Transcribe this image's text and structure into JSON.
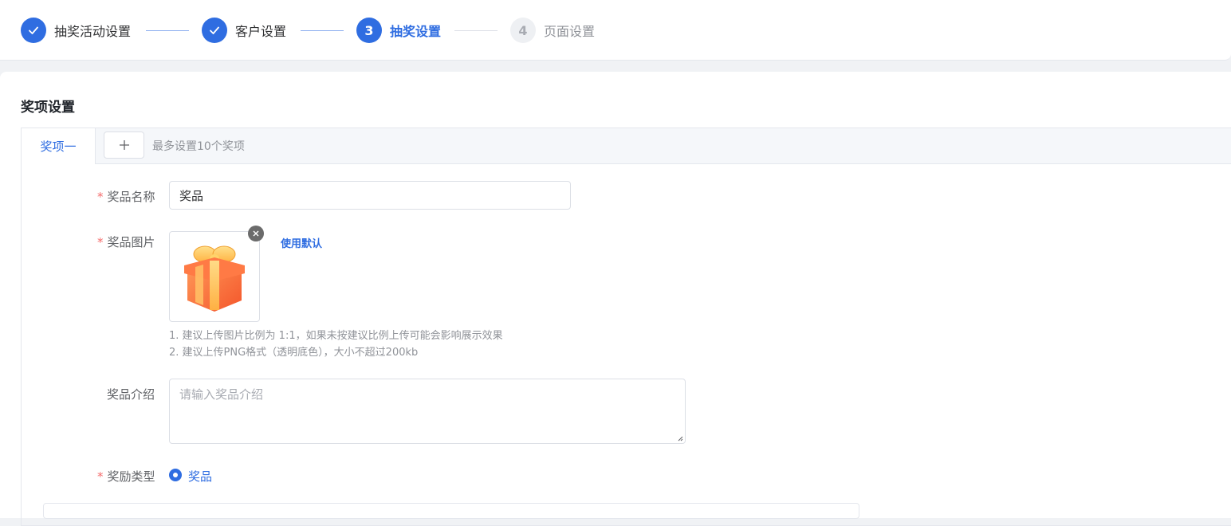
{
  "steps": [
    {
      "number": "1",
      "label": "抽奖活动设置",
      "state": "done"
    },
    {
      "number": "2",
      "label": "客户设置",
      "state": "done"
    },
    {
      "number": "3",
      "label": "抽奖设置",
      "state": "active"
    },
    {
      "number": "4",
      "label": "页面设置",
      "state": "todo"
    }
  ],
  "section": {
    "title": "奖项设置"
  },
  "tabs": {
    "items": [
      {
        "label": "奖项一"
      }
    ],
    "add_icon": "plus-icon",
    "hint": "最多设置10个奖项"
  },
  "form": {
    "prize_name": {
      "label": "奖品名称",
      "required": "*",
      "value": "奖品"
    },
    "prize_image": {
      "label": "奖品图片",
      "required": "*",
      "use_default": "使用默认",
      "image_icon": "gift-box-icon",
      "hints": [
        "1. 建议上传图片比例为 1:1，如果未按建议比例上传可能会影响展示效果",
        "2. 建议上传PNG格式（透明底色），大小不超过200kb"
      ]
    },
    "prize_desc": {
      "label": "奖品介绍",
      "placeholder": "请输入奖品介绍"
    },
    "reward_type": {
      "label": "奖励类型",
      "required": "*",
      "selected": "奖品"
    }
  },
  "colors": {
    "primary": "#2f6de1",
    "required": "#f56c6c",
    "muted": "#909399"
  }
}
